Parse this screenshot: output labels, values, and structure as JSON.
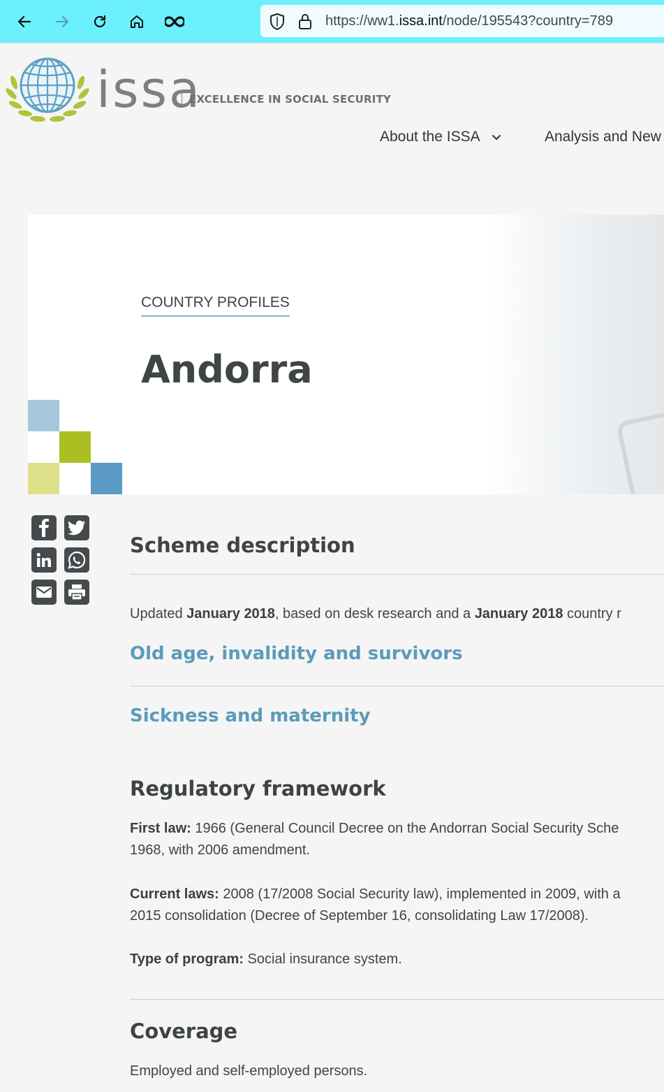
{
  "browser": {
    "url_prefix": "https://ww1.",
    "url_host": "issa.int",
    "url_path": "/node/195543?country=789",
    "icons": [
      "back-arrow-icon",
      "forward-arrow-icon",
      "reload-icon",
      "home-icon",
      "infinity-icon",
      "shield-icon",
      "lock-icon"
    ]
  },
  "header": {
    "logo_word": "issa",
    "tagline": "EXCELLENCE IN SOCIAL SECURITY",
    "menu": [
      {
        "label": "About the ISSA"
      },
      {
        "label": "Analysis and New"
      }
    ]
  },
  "hero": {
    "kicker": "COUNTRY PROFILES",
    "title": "Andorra"
  },
  "share_icons": [
    "facebook-icon",
    "twitter-icon",
    "linkedin-icon",
    "whatsapp-icon",
    "email-icon",
    "print-icon"
  ],
  "content": {
    "scheme_title": "Scheme description",
    "updated": {
      "t1": "Updated ",
      "b1": "January 2018",
      "t2": ", based on desk research and a ",
      "b2": "January 2018",
      "t3": " country r"
    },
    "link_old_age": "Old age, invalidity and survivors",
    "link_sickness": "Sickness and maternity",
    "regulatory_title": "Regulatory framework",
    "first_law_label": "First law:",
    "first_law_line1": " 1966 (General Council Decree on the Andorran Social Security Sche",
    "first_law_line2": "1968, with 2006 amendment.",
    "current_laws_label": "Current laws:",
    "current_laws_line1": " 2008 (17/2008 Social Security law), implemented in 2009, with a",
    "current_laws_line2": "2015 consolidation (Decree of September 16, consolidating Law 17/2008).",
    "type_label": "Type of program:",
    "type_value": " Social insurance system.",
    "coverage_title": "Coverage",
    "coverage_text": "Employed and self-employed persons."
  },
  "colors": {
    "browser_bar": "#6cf0fe",
    "link": "#5b9bbb",
    "square_light_blue": "#a7c8db",
    "square_lime": "#acbf22",
    "square_pale_lime": "#dfe08a",
    "square_blue": "#5b9bc6"
  }
}
